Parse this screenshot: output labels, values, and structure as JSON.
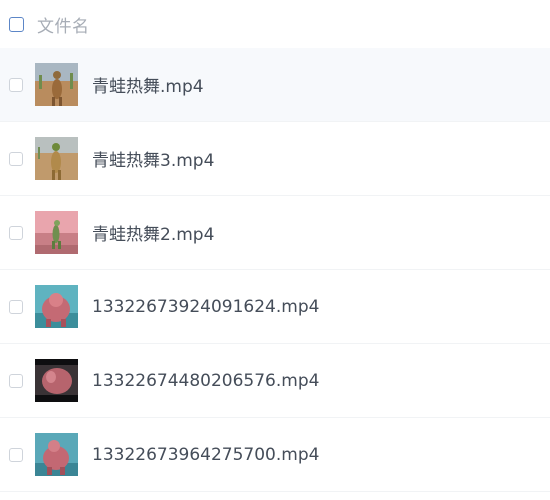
{
  "header": {
    "column_label": "文件名"
  },
  "files": [
    {
      "name": "青蛙热舞.mp4",
      "thumbnail": "dancing-frog-desert-video-thumbnail"
    },
    {
      "name": "青蛙热舞3.mp4",
      "thumbnail": "dancing-frog-desert-video-thumbnail"
    },
    {
      "name": "青蛙热舞2.mp4",
      "thumbnail": "dancing-frog-pink-sky-video-thumbnail"
    },
    {
      "name": "13322673924091624.mp4",
      "thumbnail": "pink-creature-blue-background-video-thumbnail"
    },
    {
      "name": "13322674480206576.mp4",
      "thumbnail": "pink-creature-dark-background-video-thumbnail"
    },
    {
      "name": "13322673964275700.mp4",
      "thumbnail": "pink-creature-blue-background-video-thumbnail"
    }
  ],
  "colors": {
    "text": "#454d59",
    "header_text": "#a7adb6",
    "header_checkbox": "#5c86c7",
    "row_hover_bg": "#f7f9fc",
    "divider": "#f1f3f5"
  }
}
